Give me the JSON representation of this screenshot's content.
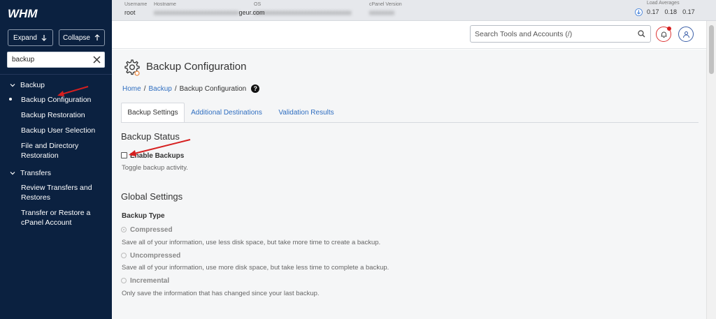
{
  "sidebar": {
    "logo": "WHM",
    "expand_label": "Expand",
    "collapse_label": "Collapse",
    "search_value": "backup",
    "groups": [
      {
        "label": "Backup",
        "items": [
          "Backup Configuration",
          "Backup Restoration",
          "Backup User Selection",
          "File and Directory Restoration"
        ]
      },
      {
        "label": "Transfers",
        "items": [
          "Review Transfers and Restores",
          "Transfer or Restore a cPanel Account"
        ]
      }
    ]
  },
  "topbar": {
    "username_label": "Username",
    "username_value": "root",
    "hostname_label": "Hostname",
    "hostname_visible_suffix": "geur.com",
    "os_label": "OS",
    "cpanel_version_label": "cPanel Version",
    "load_averages_label": "Load Averages",
    "load_averages": [
      "0.17",
      "0.18",
      "0.17"
    ]
  },
  "header": {
    "search_placeholder": "Search Tools and Accounts (/)"
  },
  "page": {
    "title": "Backup Configuration",
    "breadcrumb": [
      "Home",
      "Backup",
      "Backup Configuration"
    ],
    "help_icon": "?",
    "tabs": [
      "Backup Settings",
      "Additional Destinations",
      "Validation Results"
    ],
    "backup_status": {
      "section_title": "Backup Status",
      "enable_label": "Enable Backups",
      "enable_help": "Toggle backup activity."
    },
    "global_settings": {
      "section_title": "Global Settings",
      "backup_type_label": "Backup Type",
      "options": [
        {
          "label": "Compressed",
          "desc": "Save all of your information, use less disk space, but take more time to create a backup."
        },
        {
          "label": "Uncompressed",
          "desc": "Save all of your information, use more disk space, but take less time to complete a backup."
        },
        {
          "label": "Incremental",
          "desc": "Only save the information that has changed since your last backup."
        }
      ]
    }
  },
  "colors": {
    "sidebar_bg": "#0b2140",
    "link": "#2f6ec0",
    "annotation_arrow": "#d61f1f",
    "notification": "#d61f1f"
  }
}
